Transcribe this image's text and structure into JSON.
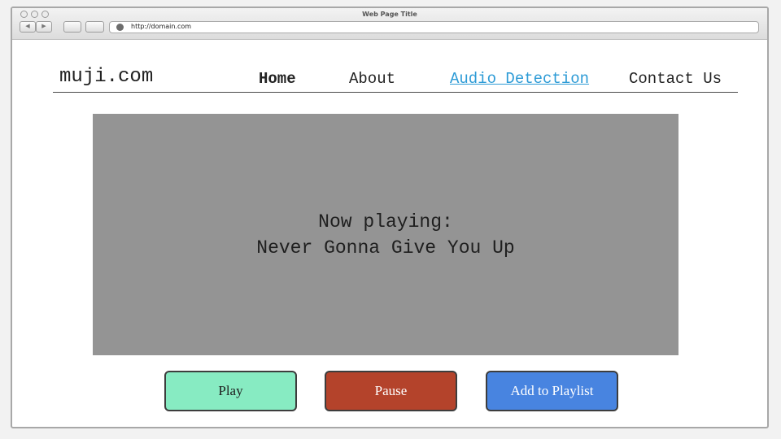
{
  "browser": {
    "window_title": "Web Page Title",
    "url": "http://domain.com",
    "back_glyph": "◀",
    "forward_glyph": "▶"
  },
  "site": {
    "logo": "muji.com"
  },
  "nav": {
    "home": "Home",
    "about": "About",
    "audio_detection": "Audio Detection",
    "contact": "Contact Us",
    "active_color": "#2d9bd6"
  },
  "player": {
    "now_playing_label": "Now playing:",
    "track_title": "Never Gonna Give You Up"
  },
  "controls": {
    "play_label": "Play",
    "pause_label": "Pause",
    "add_label": "Add to Playlist",
    "play_color": "#87ebc2",
    "pause_color": "#b4432b",
    "add_color": "#4884e0"
  }
}
